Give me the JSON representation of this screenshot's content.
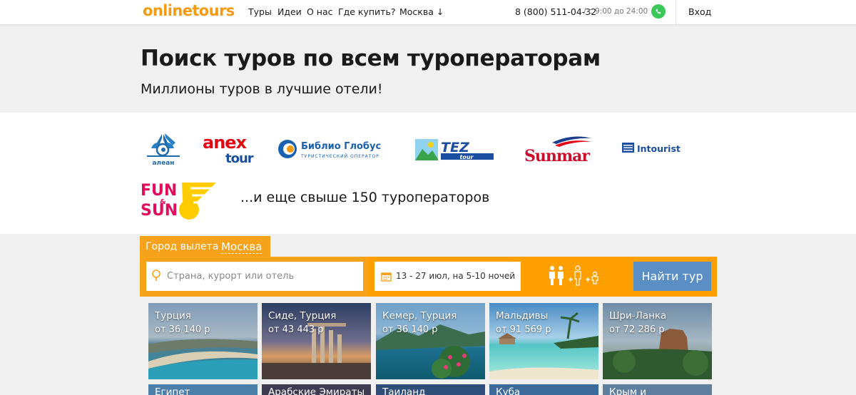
{
  "header": {
    "logo": "onlinetours",
    "nav": [
      "Туры",
      "Идеи",
      "О нас",
      "Где купить?",
      "Москва ↓"
    ],
    "phone": "8 (800) 511-04-32",
    "hours": "/ с 9:00 до 24:00",
    "login": "Вход",
    "icons": [
      "whatsapp-icon"
    ]
  },
  "hero": {
    "title": "Поиск туров по всем туроператорам",
    "subtitle": "Миллионы туров в лучшие отели!"
  },
  "operators": {
    "logos": [
      "алеан",
      "anex",
      "tour",
      "Библио Глобус",
      "ТУРИСТИЧЕСКИЙ ОПЕРАТОР",
      "TEZ",
      "tour",
      "Sunmar",
      "Intourist",
      "FUN",
      "SUN",
      "&"
    ],
    "more": "...и еще свыше 150 туроператоров"
  },
  "search": {
    "city_label": "Город вылета",
    "city_value": "Москва",
    "placeholder": "Страна, курорт или отель",
    "dates": "13 - 27 июл, на 5-10 ночей",
    "find_button": "Найти тур",
    "accent_color": "#f7a21b",
    "button_color": "#5a8ec5"
  },
  "destinations": [
    {
      "name": "Турция",
      "price": "от 36 140 р"
    },
    {
      "name": "Сиде, Турция",
      "price": "от 43 443 р"
    },
    {
      "name": "Кемер, Турция",
      "price": "от 36 140 р"
    },
    {
      "name": "Мальдивы",
      "price": "от 91 569 р"
    },
    {
      "name": "Шри-Ланка",
      "price": "от 72 286 р"
    }
  ],
  "destinations_row2": [
    {
      "name": "Египет"
    },
    {
      "name": "Арабские Эмираты"
    },
    {
      "name": "Таиланд"
    },
    {
      "name": "Куба"
    },
    {
      "name": "Крым и"
    }
  ]
}
